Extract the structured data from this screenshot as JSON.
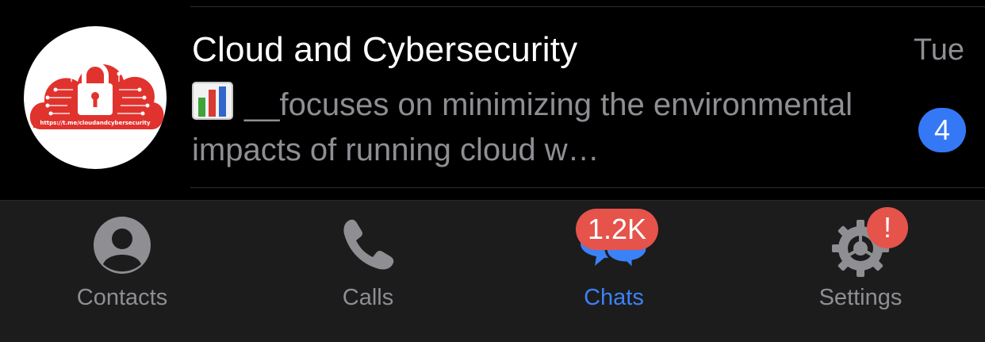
{
  "chat": {
    "title": "Cloud and Cybersecurity",
    "time": "Tue",
    "preview": "__focuses on minimizing the environmental impacts of running cloud w…",
    "unread": "4",
    "avatar_url_text": "https://t.me/cloudandcybersecurity"
  },
  "tabs": [
    {
      "label": "Contacts",
      "icon": "person-circle-icon"
    },
    {
      "label": "Calls",
      "icon": "phone-icon"
    },
    {
      "label": "Chats",
      "icon": "chat-bubbles-icon",
      "badge": "1.2K",
      "active": true
    },
    {
      "label": "Settings",
      "icon": "gear-icon",
      "badge": "!"
    }
  ],
  "colors": {
    "accent": "#3b82f6",
    "badge_red": "#e5534b",
    "unread_blue": "#3478f6",
    "avatar_red": "#e0332e"
  }
}
